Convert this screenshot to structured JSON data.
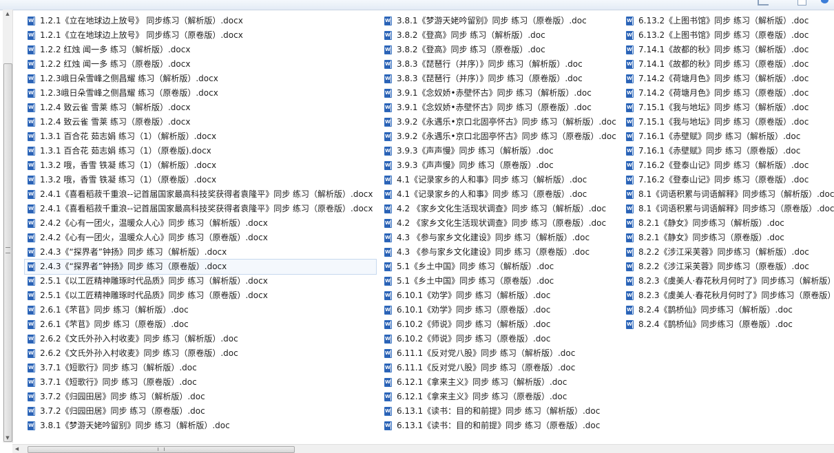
{
  "colors": {
    "icon": "#2b62b5",
    "selection": "#c6d8ee"
  },
  "columns": [
    [
      "1.2.1《立在地球边上放号》 同步练习（解析版）.docx",
      "1.2.1《立在地球边上放号》 同步练习（原卷版）.docx",
      "1.2.2 红烛 闻一多 练习（解析版）.docx",
      "1.2.2 红烛 闻一多 练习（原卷版）.docx",
      "1.2.3峨日朵雪峰之侧昌耀 练习（解析版）.docx",
      "1.2.3峨日朵雪峰之侧昌耀 练习（原卷版）.docx",
      "1.2.4 致云雀 雪莱 练习（解析版）.docx",
      "1.2.4 致云雀 雪莱 练习（原卷版）.docx",
      "1.3.1 百合花 茹志娟 练习（1）（解析版）.docx",
      "1.3.1 百合花 茹志娟 练习（1）（原卷版).docx",
      "1.3.2 哦，香雪 铁凝 练习（1）（解析版）.docx",
      "1.3.2 哦，香雪 铁凝 练习（1）（原卷版）.docx",
      "2.4.1《喜看稻菽千重浪--记首届国家最高科技奖获得者袁隆平》同步 练习（解析版）.docx",
      "2.4.1《喜看稻菽千重浪--记首届国家最高科技奖获得者袁隆平》同步 练习（原卷版）.docx",
      "2.4.2《心有一团火，温暖众人心》同步 练习（解析版）.docx",
      "2.4.2《心有一团火，温暖众人心》同步 练习（原卷版）.docx",
      "2.4.3《“探界者”钟扬》同步 练习（解析版）.docx",
      "2.4.3《“探界者”钟扬》同步 练习（原卷版）.docx",
      "2.5.1《以工匠精神雕琢时代品质》同步 练习（解析版）.docx",
      "2.5.1《以工匠精神雕琢时代品质》同步 练习（原卷版）.docx",
      "2.6.1《芣苢》同步 练习（解析版）.doc",
      "2.6.1《芣苢》同步 练习（原卷版）.doc",
      "2.6.2《文氏外孙入村收麦》同步 练习（解析版）.doc",
      "2.6.2《文氏外孙入村收麦》同步 练习（原卷版）.doc",
      "3.7.1《短歌行》同步 练习（解析版）.doc",
      "3.7.1《短歌行》同步 练习（原卷版）.doc",
      "3.7.2《归园田居》同步 练习（解析版）.doc",
      "3.7.2《归园田居》同步 练习（原卷版）.doc",
      "3.8.1《梦游天姥吟留别》同步 练习（解析版）.doc"
    ],
    [
      "3.8.1《梦游天姥吟留别》同步 练习（原卷版）.doc",
      "3.8.2《登高》同步 练习（解析版）.doc",
      "3.8.2《登高》同步 练习（原卷版）.doc",
      "3.8.3《琵琶行（并序）》同步 练习（解析版）.doc",
      "3.8.3《琵琶行（并序）》同步 练习（原卷版）.doc",
      "3.9.1《念奴娇•赤壁怀古》同步 练习（解析版）.doc",
      "3.9.1《念奴娇•赤壁怀古》同步 练习（原卷版）.doc",
      "3.9.2《永遇乐•京口北固亭怀古》同步 练习（解析版）.doc",
      "3.9.2《永遇乐•京口北固亭怀古》同步 练习（原卷版）.doc",
      "3.9.3《声声慢》同步 练习（解析版）.doc",
      "3.9.3《声声慢》同步 练习（原卷版）.doc",
      "4.1《记录家乡的人和事》同步 练习（解析版）.doc",
      "4.1《记录家乡的人和事》同步 练习（原卷版）.doc",
      "4.2 《家乡文化生活现状调查》同步 练习（解析版）.doc",
      "4.2 《家乡文化生活现状调查》同步 练习（原卷版）.doc",
      "4.3 《参与家乡文化建设》同步 练习（解析版）.doc",
      "4.3 《参与家乡文化建设》同步 练习（原卷版）.doc",
      "5.1《乡土中国》同步 练习（解析版）.doc",
      "5.1《乡土中国》同步 练习（原卷版）.doc",
      "6.10.1《劝学》同步 练习（解析版）.doc",
      "6.10.1《劝学》同步 练习（原卷版）.doc",
      "6.10.2《师说》同步 练习（解析版）.doc",
      "6.10.2《师说》同步 练习（原卷版）.doc",
      "6.11.1《反对党八股》同步 练习（解析版）.doc",
      "6.11.1《反对党八股》同步 练习（原卷版）.doc",
      "6.12.1《拿来主义》同步 练习（解析版）.doc",
      "6.12.1《拿来主义》同步 练习（原卷版）.doc",
      "6.13.1《读书：目的和前提》同步 练习（解析版）.doc",
      "6.13.1《读书：目的和前提》同步 练习（原卷版）.doc"
    ],
    [
      "6.13.2《上图书馆》同步 练习（解析版）.doc",
      "6.13.2《上图书馆》同步 练习（原卷版）.doc",
      "7.14.1《故都的秋》同步 练习（解析版）.doc",
      "7.14.1《故都的秋》同步 练习（原卷版）.doc",
      "7.14.2《荷塘月色》同步 练习（解析版）.doc",
      "7.14.2《荷塘月色》同步 练习（原卷版）.doc",
      "7.15.1《我与地坛》同步 练习（解析版）.doc",
      "7.15.1《我与地坛》同步 练习（原卷版）.doc",
      "7.16.1《赤壁赋》同步 练习（解析版）.doc",
      "7.16.1《赤壁赋》同步 练习（原卷版）.doc",
      "7.16.2《登泰山记》同步 练习（解析版）.doc",
      "7.16.2《登泰山记》同步 练习（原卷版）.doc",
      "8.1《词语积累与词语解释》同步练习（解析版）.doc",
      "8.1《词语积累与词语解释》同步练习（原卷版）.doc",
      "8.2.1《静女》同步练习（解析版）.doc",
      "8.2.1《静女》同步练习（原卷版）.doc",
      "8.2.2《涉江采芙蓉》同步练习（解析版）.doc",
      "8.2.2《涉江采芙蓉》同步练习（原卷版）.doc",
      "8.2.3《虞美人·春花秋月何时了》同步练习（解析版）",
      "8.2.3《虞美人·春花秋月何时了》同步练习（原卷版）",
      "8.2.4《鹊桥仙》同步练习（解析版）.doc",
      "8.2.4《鹊桥仙》同步练习（原卷版）.doc"
    ]
  ],
  "selected": {
    "column": 0,
    "index": 17
  }
}
